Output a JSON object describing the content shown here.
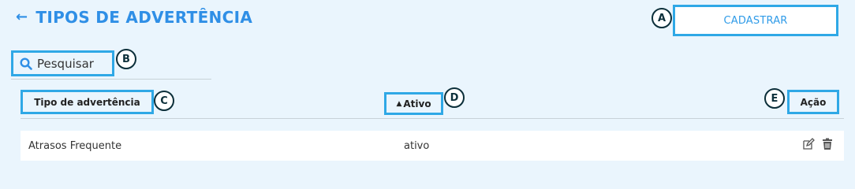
{
  "header": {
    "title": "TIPOS DE ADVERTÊNCIA",
    "back_icon": "arrow-left-icon"
  },
  "toolbar": {
    "add_label": "CADASTRAR"
  },
  "search": {
    "placeholder": "Pesquisar",
    "icon": "search-icon"
  },
  "table": {
    "columns": [
      {
        "label": "Tipo de advertência"
      },
      {
        "label": "Ativo",
        "sortable": true
      },
      {
        "label": "Ação"
      }
    ],
    "rows": [
      {
        "tipo": "Atrasos Frequente",
        "ativo": "ativo",
        "actions": [
          "edit-icon",
          "trash-icon"
        ]
      }
    ]
  },
  "annotations": {
    "a": "A",
    "b": "B",
    "c": "C",
    "d": "D",
    "e": "E"
  },
  "colors": {
    "accent": "#2f8fe6",
    "highlight_border": "#2fa8e6",
    "background": "#eaf5fd",
    "badge_border": "#0c2f3a"
  }
}
